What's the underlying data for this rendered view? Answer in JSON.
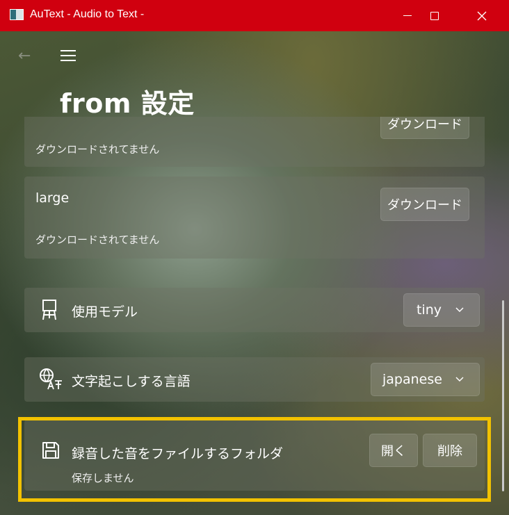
{
  "window": {
    "title": "AuText - Audio to Text -",
    "minimize_glyph": "—",
    "maximize_glyph": "☐",
    "close_glyph": "✕"
  },
  "nav": {
    "back_glyph": "←"
  },
  "page": {
    "title": "from 設定"
  },
  "models": [
    {
      "name": "",
      "status": "ダウンロードされてません",
      "button": "ダウンロード"
    },
    {
      "name": "large",
      "status": "ダウンロードされてません",
      "button": "ダウンロード"
    }
  ],
  "settings": {
    "model": {
      "label": "使用モデル",
      "value": "tiny",
      "icon": "easel-icon"
    },
    "language": {
      "label": "文字起こしする言語",
      "value": "japanese",
      "icon": "translate-icon"
    },
    "folder": {
      "label": "録音した音をファイルするフォルダ",
      "status": "保存しません",
      "open_button": "開く",
      "delete_button": "削除",
      "icon": "save-icon"
    }
  },
  "colors": {
    "titlebar": "#d0000f",
    "highlight": "#f2c200"
  }
}
